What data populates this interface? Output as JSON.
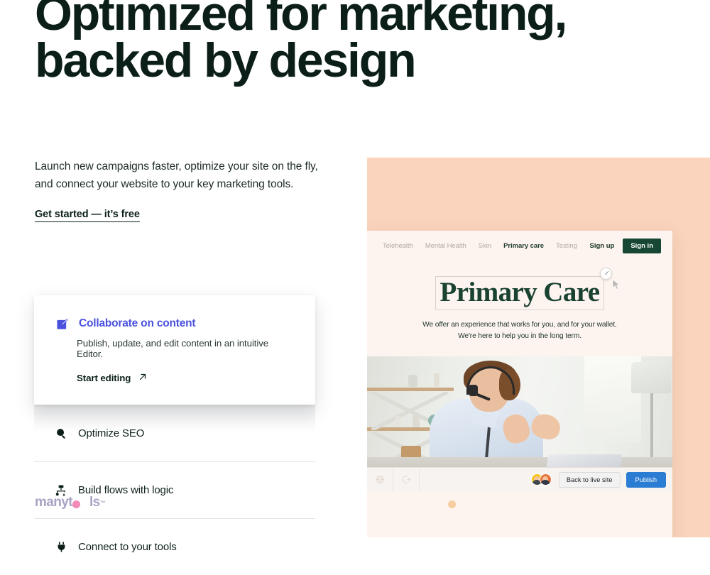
{
  "hero": {
    "headline_line1": "Optimized for marketing,",
    "headline_line2": "backed by design",
    "lede_line1": "Launch new campaigns faster, optimize your site on the fly,",
    "lede_line2": "and connect your website to your key marketing tools.",
    "cta_label": "Get started — it’s free"
  },
  "accordion": {
    "expanded": {
      "icon": "edit-square-icon",
      "title": "Collaborate on content",
      "description": "Publish, update, and edit content in an intuitive Editor.",
      "link_label": "Start editing",
      "link_icon": "arrow-up-right-icon",
      "accent_color": "#4a52de"
    },
    "items": [
      {
        "icon": "magnifier-icon",
        "label": "Optimize SEO"
      },
      {
        "icon": "flow-branch-icon",
        "label": "Build flows with logic"
      },
      {
        "icon": "plug-icon",
        "label": "Connect to your tools"
      }
    ]
  },
  "watermark": {
    "text_before": "manyt",
    "text_after": "ls",
    "trademark": "™",
    "dot1_color": "#f289b8",
    "dot2_color": "#f8cda2",
    "text_color": "#a9a3c4"
  },
  "mockup": {
    "panel_bg": "#fad4bc",
    "site": {
      "nav_links": [
        {
          "label": "Telehealth",
          "active": false
        },
        {
          "label": "Mental Health",
          "active": false
        },
        {
          "label": "Skin",
          "active": false
        },
        {
          "label": "Primary care",
          "active": true
        },
        {
          "label": "Testing",
          "active": false
        }
      ],
      "sign_up_label": "Sign up",
      "sign_in_label": "Sign in",
      "sign_in_color": "#174734",
      "hero_title": "Primary Care",
      "hero_sub_line1": "We offer an experience that works for you, and for your",
      "hero_sub_line2": "wallet. We're here to help you in the long term.",
      "edit_badge_icon": "pencil-icon",
      "cursor_icon": "cursor-arrow-icon"
    },
    "toolbar": {
      "left_icons": [
        {
          "icon": "settings-wheel-icon"
        },
        {
          "icon": "animation-icon"
        }
      ],
      "avatars": [
        {
          "name": "avatar-user-1",
          "ring_color": "#f5c518"
        },
        {
          "name": "avatar-user-2",
          "ring_color": "#e8713a"
        }
      ],
      "back_label": "Back to live site",
      "publish_label": "Publish",
      "publish_color": "#2b7cd3"
    }
  }
}
